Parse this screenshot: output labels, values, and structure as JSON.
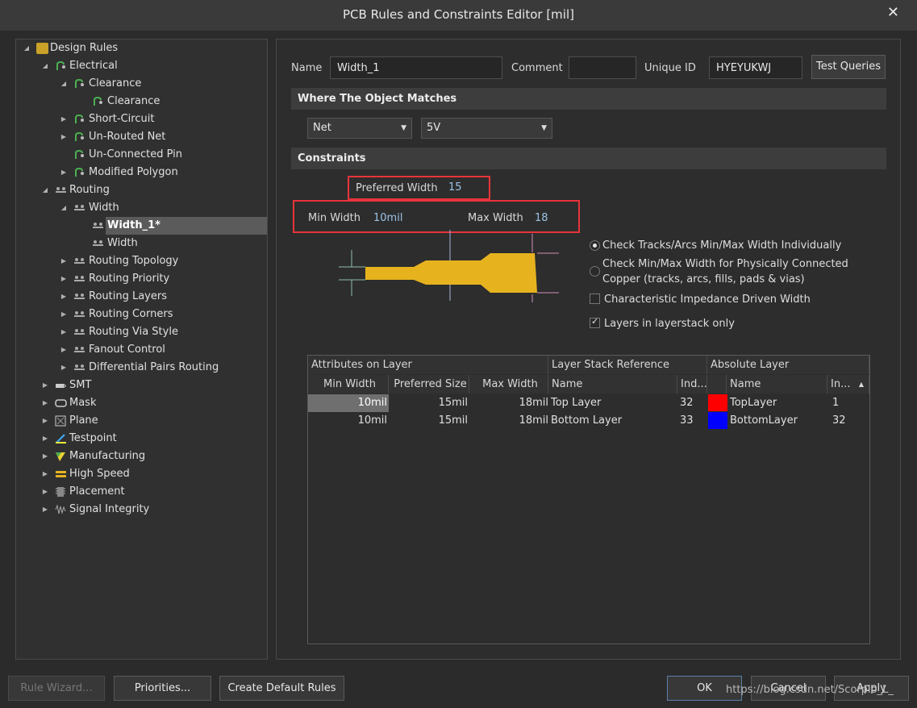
{
  "window": {
    "title": "PCB Rules and Constraints Editor [mil]"
  },
  "tree": {
    "design_rules": "Design Rules",
    "electrical": "Electrical",
    "clearance_cat": "Clearance",
    "clearance_rule": "Clearance",
    "short_circuit": "Short-Circuit",
    "un_routed_net": "Un-Routed Net",
    "un_connected_pin": "Un-Connected Pin",
    "modified_polygon": "Modified Polygon",
    "routing": "Routing",
    "width_cat": "Width",
    "width_1": "Width_1*",
    "width_rule": "Width",
    "routing_topology": "Routing Topology",
    "routing_priority": "Routing Priority",
    "routing_layers": "Routing Layers",
    "routing_corners": "Routing Corners",
    "routing_via_style": "Routing Via Style",
    "fanout_control": "Fanout Control",
    "diff_pairs": "Differential Pairs Routing",
    "smt": "SMT",
    "mask": "Mask",
    "plane": "Plane",
    "testpoint": "Testpoint",
    "manufacturing": "Manufacturing",
    "high_speed": "High Speed",
    "placement": "Placement",
    "signal_integrity": "Signal Integrity"
  },
  "rule": {
    "name_label": "Name",
    "name_value": "Width_1",
    "comment_label": "Comment",
    "comment_value": "",
    "unique_id_label": "Unique ID",
    "unique_id_value": "HYEYUKWJ",
    "test_queries": "Test Queries"
  },
  "match": {
    "header": "Where The Object Matches",
    "type": "Net",
    "net": "5V"
  },
  "constraints": {
    "header": "Constraints",
    "preferred_label": "Preferred Width",
    "preferred_value": "15",
    "min_label": "Min Width",
    "min_value": "10mil",
    "max_label": "Max Width",
    "max_value": "18",
    "opt_individually": "Check Tracks/Arcs Min/Max Width Individually",
    "opt_connected_1": "Check Min/Max Width for Physically Connected",
    "opt_connected_2": "Copper (tracks, arcs, fills, pads & vias)",
    "opt_impedance": "Characteristic Impedance Driven Width",
    "opt_layerstack": "Layers in layerstack only"
  },
  "grid": {
    "group_attrs": "Attributes on Layer",
    "group_stack": "Layer Stack Reference",
    "group_abs": "Absolute Layer",
    "col_min": "Min Width",
    "col_pref": "Preferred Size",
    "col_max": "Max Width",
    "col_name": "Name",
    "col_ind": "Ind...",
    "col_abs_name": "Name",
    "col_abs_in": "In...",
    "rows": [
      {
        "min": "10mil",
        "pref": "15mil",
        "max": "18mil",
        "name": "Top Layer",
        "ind": "32",
        "color": "#ff0000",
        "abs_name": "TopLayer",
        "abs_in": "1"
      },
      {
        "min": "10mil",
        "pref": "15mil",
        "max": "18mil",
        "name": "Bottom Layer",
        "ind": "33",
        "color": "#0000ff",
        "abs_name": "BottomLayer",
        "abs_in": "32"
      }
    ]
  },
  "footer": {
    "rule_wizard": "Rule Wizard...",
    "priorities": "Priorities...",
    "create_default": "Create Default Rules",
    "ok": "OK",
    "cancel": "Cancel",
    "apply": "Apply"
  },
  "watermark": "https://blog.csdn.net/Scorpio_L_",
  "colors": {
    "copper": "#e6b31e",
    "highlight": "#e8343b",
    "selection": "#5b5b5b"
  }
}
